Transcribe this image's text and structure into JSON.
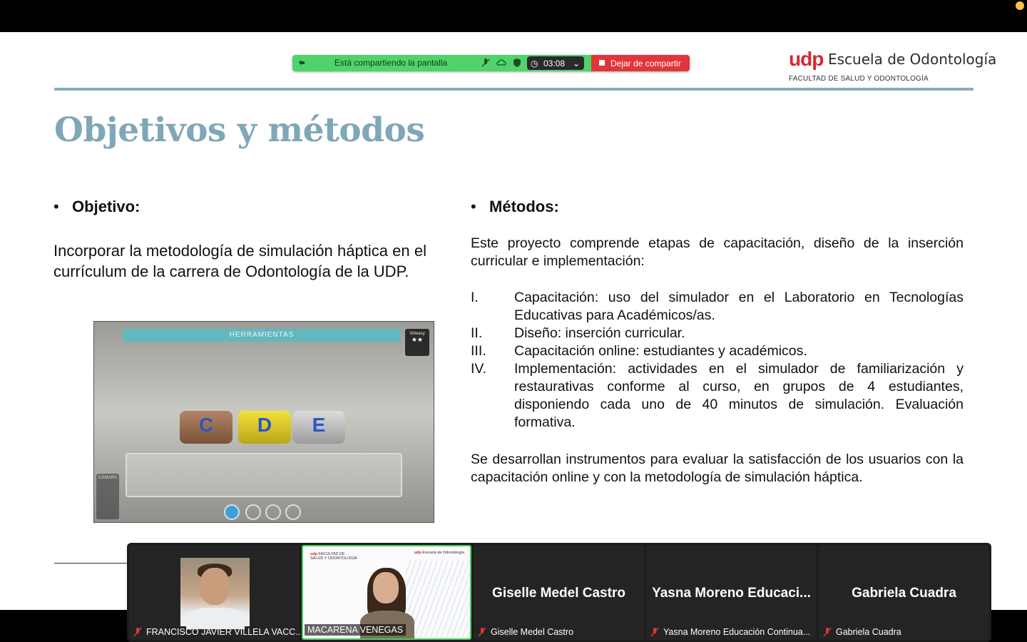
{
  "share_bar": {
    "status": "Está compartiendo la pantalla",
    "timer": "03:08",
    "stop_label": "Dejar de compartir",
    "colors": {
      "green": "#4fd36a",
      "red": "#e0363a"
    }
  },
  "logo": {
    "brand": "udp",
    "school": "Escuela de Odontología",
    "faculty": "FACULTAD DE SALUD Y ODONTOLOGÍA"
  },
  "slide": {
    "title": "Objetivos y métodos",
    "objetivo_heading": "Objetivo:",
    "objetivo_text": "Incorporar la metodología de simulación háptica en el currículum de la carrera de Odontología de la UDP.",
    "simulator": {
      "header": "HERRAMIENTAS",
      "badge": "Virteasy",
      "blocks": [
        "C",
        "D",
        "E"
      ],
      "camera_label": "CÁMARA"
    },
    "metodos_heading": "Métodos:",
    "metodos_intro": "Este proyecto comprende etapas de capacitación, diseño de la inserción curricular e implementación:",
    "metodos_items": [
      {
        "num": "I.",
        "text": "Capacitación: uso del simulador en el Laboratorio en Tecnologías Educativas para Académicos/as."
      },
      {
        "num": "II.",
        "text": "Diseño: inserción curricular."
      },
      {
        "num": "III.",
        "text": "Capacitación online: estudiantes y académicos."
      },
      {
        "num": "IV.",
        "text": "Implementación: actividades en el simulador de familiarización y restaurativas conforme al curso, en grupos de 4 estudiantes, disponiendo cada uno de 40 minutos de simulación. Evaluación formativa."
      }
    ],
    "metodos_outro": "Se desarrollan instrumentos para evaluar la satisfacción de los usuarios con la capacitación online y con la metodología de simulación háptica."
  },
  "participants": [
    {
      "label": "FRANCISCO JAVIER VILLELA VACC...",
      "big": "",
      "type": "photo"
    },
    {
      "label": "MACARENA VENEGAS",
      "big": "",
      "type": "video"
    },
    {
      "label": "Giselle Medel Castro",
      "big": "Giselle Medel Castro",
      "type": "name"
    },
    {
      "label": "Yasna Moreno Educación Continua...",
      "big": "Yasna Moreno Educaci...",
      "type": "name"
    },
    {
      "label": "Gabriela Cuadra",
      "big": "Gabriela Cuadra",
      "type": "name"
    }
  ]
}
